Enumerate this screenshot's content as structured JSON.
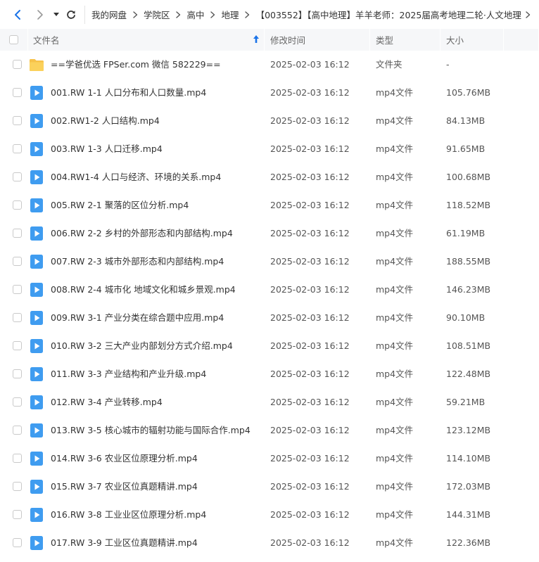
{
  "breadcrumb": [
    "我的网盘",
    "学院区",
    "高中",
    "地理",
    "【003552】【高中地理】羊羊老师：2025届高考地理二轮·人文地理"
  ],
  "header": {
    "name": "文件名",
    "time": "修改时间",
    "type": "类型",
    "size": "大小"
  },
  "colors": {
    "accent": "#1a73e8",
    "folder": "#f7c24a",
    "video": "#3f9cf0",
    "header_bg": "#f6f7f9"
  },
  "rows": [
    {
      "icon": "folder-icon",
      "name": "==学爸优选 FPSer.com 微信 582229==",
      "time": "2025-02-03 16:12",
      "type": "文件夹",
      "size": "-"
    },
    {
      "icon": "video-file-icon",
      "name": "001.RW 1-1 人口分布和人口数量.mp4",
      "time": "2025-02-03 16:12",
      "type": "mp4文件",
      "size": "105.76MB"
    },
    {
      "icon": "video-file-icon",
      "name": "002.RW1-2 人口结构.mp4",
      "time": "2025-02-03 16:12",
      "type": "mp4文件",
      "size": "84.13MB"
    },
    {
      "icon": "video-file-icon",
      "name": "003.RW 1-3  人口迁移.mp4",
      "time": "2025-02-03 16:12",
      "type": "mp4文件",
      "size": "91.65MB"
    },
    {
      "icon": "video-file-icon",
      "name": "004.RW1-4 人口与经济、环境的关系.mp4",
      "time": "2025-02-03 16:12",
      "type": "mp4文件",
      "size": "100.68MB"
    },
    {
      "icon": "video-file-icon",
      "name": "005.RW 2-1 聚落的区位分析.mp4",
      "time": "2025-02-03 16:12",
      "type": "mp4文件",
      "size": "118.52MB"
    },
    {
      "icon": "video-file-icon",
      "name": "006.RW 2-2 乡村的外部形态和内部结构.mp4",
      "time": "2025-02-03 16:12",
      "type": "mp4文件",
      "size": "61.19MB"
    },
    {
      "icon": "video-file-icon",
      "name": "007.RW 2-3 城市外部形态和内部结构.mp4",
      "time": "2025-02-03 16:12",
      "type": "mp4文件",
      "size": "188.55MB"
    },
    {
      "icon": "video-file-icon",
      "name": "008.RW 2-4 城市化 地域文化和城乡景观.mp4",
      "time": "2025-02-03 16:12",
      "type": "mp4文件",
      "size": "146.23MB"
    },
    {
      "icon": "video-file-icon",
      "name": "009.RW 3-1 产业分类在综合题中应用.mp4",
      "time": "2025-02-03 16:12",
      "type": "mp4文件",
      "size": "90.10MB"
    },
    {
      "icon": "video-file-icon",
      "name": "010.RW 3-2 三大产业内部划分方式介绍.mp4",
      "time": "2025-02-03 16:12",
      "type": "mp4文件",
      "size": "108.51MB"
    },
    {
      "icon": "video-file-icon",
      "name": "011.RW 3-3 产业结构和产业升级.mp4",
      "time": "2025-02-03 16:12",
      "type": "mp4文件",
      "size": "122.48MB"
    },
    {
      "icon": "video-file-icon",
      "name": "012.RW 3-4  产业转移.mp4",
      "time": "2025-02-03 16:12",
      "type": "mp4文件",
      "size": "59.21MB"
    },
    {
      "icon": "video-file-icon",
      "name": "013.RW 3-5 核心城市的辐射功能与国际合作.mp4",
      "time": "2025-02-03 16:12",
      "type": "mp4文件",
      "size": "123.12MB"
    },
    {
      "icon": "video-file-icon",
      "name": "014.RW 3-6 农业区位原理分析.mp4",
      "time": "2025-02-03 16:12",
      "type": "mp4文件",
      "size": "114.10MB"
    },
    {
      "icon": "video-file-icon",
      "name": "015.RW 3-7 农业区位真题精讲.mp4",
      "time": "2025-02-03 16:12",
      "type": "mp4文件",
      "size": "172.03MB"
    },
    {
      "icon": "video-file-icon",
      "name": "016.RW 3-8 工业业区位原理分析.mp4",
      "time": "2025-02-03 16:12",
      "type": "mp4文件",
      "size": "144.31MB"
    },
    {
      "icon": "video-file-icon",
      "name": "017.RW 3-9 工业区位真题精讲.mp4",
      "time": "2025-02-03 16:12",
      "type": "mp4文件",
      "size": "122.36MB"
    }
  ]
}
